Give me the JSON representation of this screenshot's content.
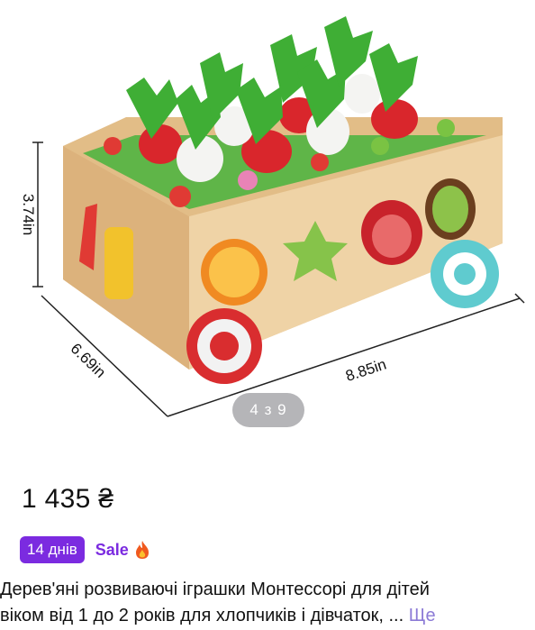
{
  "gallery": {
    "dimension_height": "3.74in",
    "dimension_depth": "6.69in",
    "dimension_width": "8.85in",
    "counter": "4 з 9"
  },
  "listing": {
    "price": "1 435 ₴",
    "badge_days": "14 днів",
    "sale_label": "Sale",
    "title_line1": "Дерев'яні розвиваючі іграшки Монтессорі для дітей",
    "title_line2": "віком від 1 до 2 років для хлопчиків і дівчаток, ...",
    "more_label": "Ще"
  },
  "colors": {
    "accent": "#7b2be0",
    "more_link": "#8c7bd6"
  }
}
